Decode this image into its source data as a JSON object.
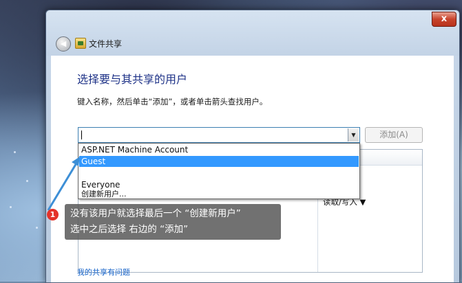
{
  "window": {
    "close_label": "x",
    "nav_title": "文件共享",
    "back_icon": "back-arrow-icon",
    "share_icon": "file-share-icon"
  },
  "content": {
    "heading": "选择要与其共享的用户",
    "instruction": "键入名称，然后单击“添加”，或者单击箭头查找用户。",
    "name_input_value": "",
    "add_button": "添加(A)",
    "help_link": "我的共享有问题"
  },
  "dropdown": {
    "items": [
      {
        "label": "ASP.NET Machine Account",
        "selected": false
      },
      {
        "label": "Guest",
        "selected": true
      },
      {
        "label": "Everyone",
        "selected": false
      },
      {
        "label": "创建新用户...",
        "selected": false
      }
    ]
  },
  "table": {
    "permission_cell": "读取/写入 ▼"
  },
  "annotation": {
    "number": "1",
    "line1": "没有该用户就选择最后一个 “创建新用户”",
    "line2": "选中之后选择 右边的  “添加”",
    "accent_color": "#e4332a",
    "arrow_color": "#3d8fd6"
  }
}
